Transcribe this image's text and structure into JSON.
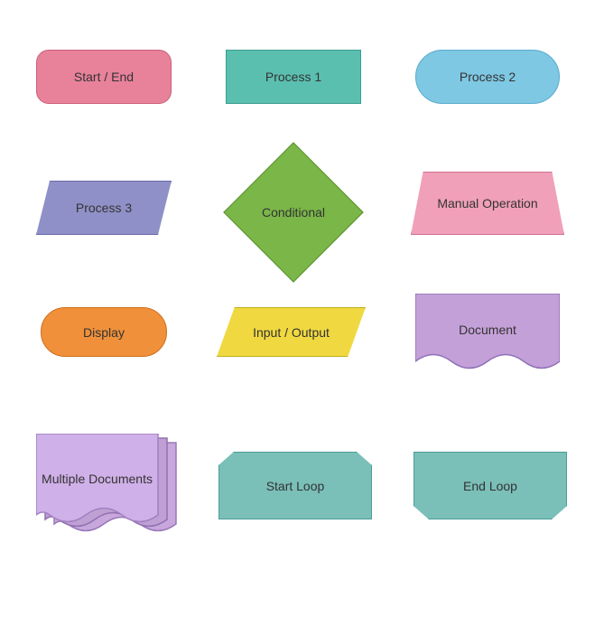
{
  "shapes": {
    "start_end": {
      "label": "Start / End"
    },
    "process1": {
      "label": "Process 1"
    },
    "process2": {
      "label": "Process 2"
    },
    "process3": {
      "label": "Process 3"
    },
    "conditional": {
      "label": "Conditional"
    },
    "manual_operation": {
      "label": "Manual Operation"
    },
    "display": {
      "label": "Display"
    },
    "input_output": {
      "label": "Input / Output"
    },
    "document": {
      "label": "Document"
    },
    "multiple_documents": {
      "label": "Multiple Documents"
    },
    "start_loop": {
      "label": "Start Loop"
    },
    "end_loop": {
      "label": "End Loop"
    }
  }
}
